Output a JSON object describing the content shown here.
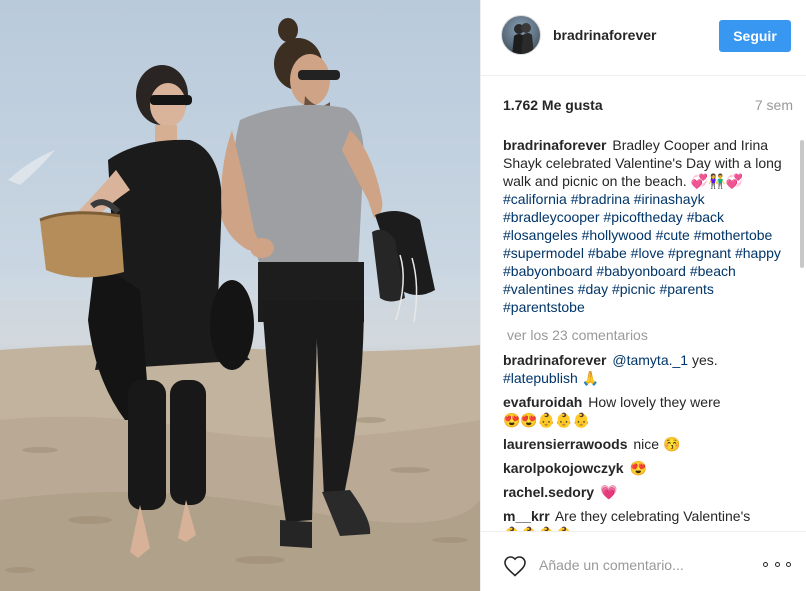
{
  "post": {
    "username": "bradrinaforever",
    "follow_label": "Seguir",
    "likes": "1.762 Me gusta",
    "time": "7 sem"
  },
  "caption": {
    "username": "bradrinaforever",
    "text": "Bradley Cooper and Irina Shayk celebrated Valentine's Day with a long walk and picnic on the beach.",
    "emoji": "💞👫💞",
    "hashtags": [
      "#california",
      "#bradrina",
      "#irinashayk",
      "#bradleycooper",
      "#picoftheday",
      "#back",
      "#losangeles",
      "#hollywood",
      "#cute",
      "#mothertobe",
      "#supermodel",
      "#babe",
      "#love",
      "#pregnant",
      "#happy",
      "#babyonboard",
      "#babyonboard",
      "#beach",
      "#valentines",
      "#day",
      "#picnic",
      "#parents",
      "#parentstobe"
    ]
  },
  "view_more": "ver los 23 comentarios",
  "comments": [
    {
      "username": "bradrinaforever",
      "mention": "@tamyta._1",
      "text": " yes.",
      "tag": "#latepublish",
      "emoji": "🙏"
    },
    {
      "username": "evafuroidah",
      "text": "How lovely they were",
      "emoji": "😍😍👶👶👶"
    },
    {
      "username": "laurensierrawoods",
      "text": "nice",
      "emoji": "😚"
    },
    {
      "username": "karolpokojowczyk",
      "text": "",
      "emoji": "😍"
    },
    {
      "username": "rachel.sedory",
      "text": "",
      "emoji": "💗"
    },
    {
      "username": "m__krr",
      "text": "Are they celebrating Valentine's",
      "emoji": "👶👶👶👶"
    }
  ],
  "footer": {
    "comment_placeholder": "Añade un comentario...",
    "heart_icon": "heart-icon",
    "more_icon": "more-options-icon"
  },
  "colors": {
    "accent": "#3897f0",
    "hashtag": "#003569",
    "muted": "#999999"
  }
}
